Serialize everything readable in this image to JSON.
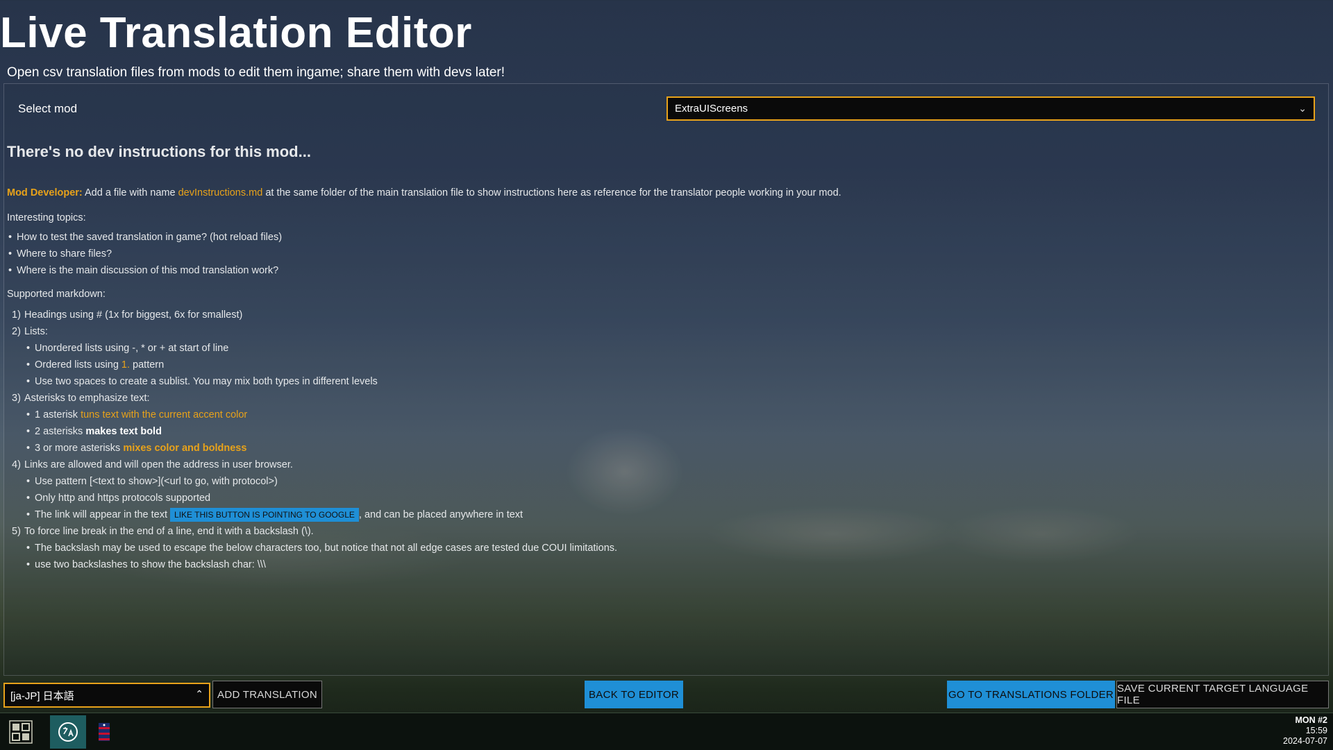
{
  "header": {
    "title": "Live Translation Editor",
    "subtitle": "Open csv translation files from mods to edit them ingame; share them with devs later!"
  },
  "mod_select": {
    "label": "Select mod",
    "value": "ExtraUIScreens"
  },
  "content": {
    "heading": "There's no dev instructions for this mod...",
    "dev_prefix": "Mod Developer:",
    "dev_text_1": " Add a file with name ",
    "dev_file": "devInstructions.md",
    "dev_text_2": " at the same folder of the main translation file to show instructions here as reference for the translator people working in your mod.",
    "topics_label": "Interesting topics:",
    "topics": [
      "How to test the saved translation in game? (hot reload files)",
      "Where to share files?",
      "Where is the main discussion of this mod translation work?"
    ],
    "markdown_label": "Supported markdown:",
    "md1": "Headings using # (1x for biggest, 6x for smallest)",
    "md2": "Lists:",
    "md2_a": "Unordered lists using -, * or + at start of line",
    "md2_b_pre": "Ordered lists using ",
    "md2_b_accent": "1.",
    "md2_b_post": " pattern",
    "md2_c": "Use two spaces to create a sublist. You may mix both types in different levels",
    "md3": "Asterisks to emphasize text:",
    "md3_a_pre": "1 asterisk ",
    "md3_a_accent": "tuns text with the current accent color",
    "md3_b_pre": "2 asterisks ",
    "md3_b_bold": "makes text bold",
    "md3_c_pre": "3 or more asterisks ",
    "md3_c_accent": "mixes color and boldness",
    "md4": "Links are allowed and will open the address in user browser.",
    "md4_a": "Use pattern [<text to show>](<url to go, with protocol>)",
    "md4_b": "Only http and https protocols supported",
    "md4_c_pre": "The link will appear in the text ",
    "md4_c_link": "LIKE THIS BUTTON IS POINTING TO GOOGLE",
    "md4_c_post": ", and can be placed anywhere in text",
    "md5": "To force line break in the end of a line, end it with a backslash (\\).",
    "md5_a": "The backslash may be used to escape the below characters too, but notice that not all edge cases are tested due COUI limitations.",
    "md5_b": "use two backslashes to show the backslash char: \\\\\\"
  },
  "footer": {
    "language_value": "[ja-JP] 日本語",
    "add_translation": "ADD TRANSLATION",
    "back_to_editor": "BACK TO EDITOR",
    "go_to_folder": "GO TO TRANSLATIONS FOLDER",
    "save_file": "SAVE CURRENT TARGET LANGUAGE FILE"
  },
  "taskbar": {
    "day": "MON #2",
    "time": "15:59",
    "date": "2024-07-07"
  },
  "colors": {
    "accent": "#e8a21a",
    "link_button": "#1f8fd6"
  }
}
